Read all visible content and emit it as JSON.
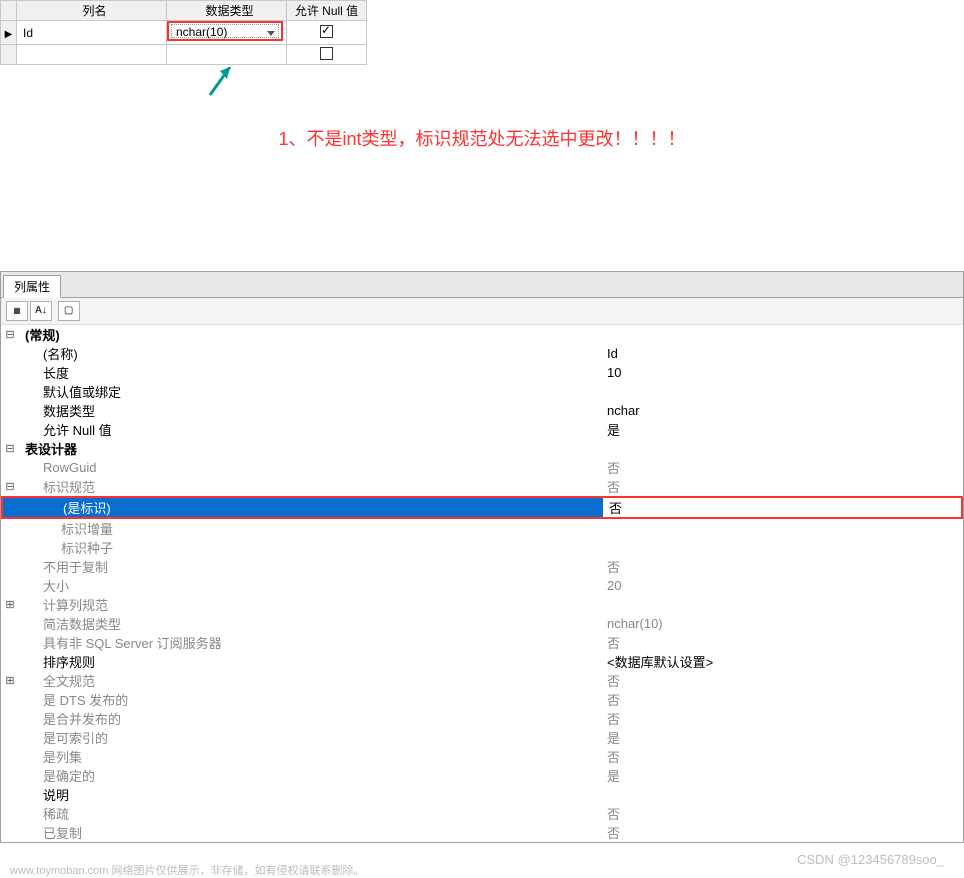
{
  "top_table": {
    "headers": {
      "col1": "列名",
      "col2": "数据类型",
      "col3": "允许 Null 值"
    },
    "row": {
      "name": "Id",
      "type": "nchar(10)",
      "allow_null": true
    }
  },
  "caption": "1、不是int类型，标识规范处无法选中更改！！！！",
  "panel": {
    "tab": "列属性",
    "groups": {
      "general": {
        "label": "(常规)",
        "name_label": "(名称)",
        "name_value": "Id",
        "length_label": "长度",
        "length_value": "10",
        "default_label": "默认值或绑定",
        "default_value": "",
        "type_label": "数据类型",
        "type_value": "nchar",
        "null_label": "允许 Null 值",
        "null_value": "是"
      },
      "designer": {
        "label": "表设计器",
        "rowguid_label": "RowGuid",
        "rowguid_value": "否",
        "identity_label": "标识规范",
        "identity_value": "否",
        "is_identity_label": "(是标识)",
        "is_identity_value": "否",
        "increment_label": "标识增量",
        "increment_value": "",
        "seed_label": "标识种子",
        "seed_value": "",
        "notrepl_label": "不用于复制",
        "notrepl_value": "否",
        "size_label": "大小",
        "size_value": "20",
        "computed_label": "计算列规范",
        "computed_value": "",
        "concise_label": "简洁数据类型",
        "concise_value": "nchar(10)",
        "nonmssql_label": "具有非 SQL Server 订阅服务器",
        "nonmssql_value": "否",
        "collation_label": "排序规则",
        "collation_value": "<数据库默认设置>",
        "fulltext_label": "全文规范",
        "fulltext_value": "否",
        "dts_label": "是 DTS 发布的",
        "dts_value": "否",
        "merge_label": "是合并发布的",
        "merge_value": "否",
        "index_label": "是可索引的",
        "index_value": "是",
        "colset_label": "是列集",
        "colset_value": "否",
        "deterministic_label": "是确定的",
        "deterministic_value": "是",
        "desc_label": "说明",
        "desc_value": "",
        "sparse_label": "稀疏",
        "sparse_value": "否",
        "replicated_label": "已复制",
        "replicated_value": "否"
      }
    }
  },
  "watermark": {
    "left": "www.toymoban.com 网络图片仅供展示，非存储，如有侵权请联系删除。",
    "right": "CSDN @123456789soo_"
  }
}
